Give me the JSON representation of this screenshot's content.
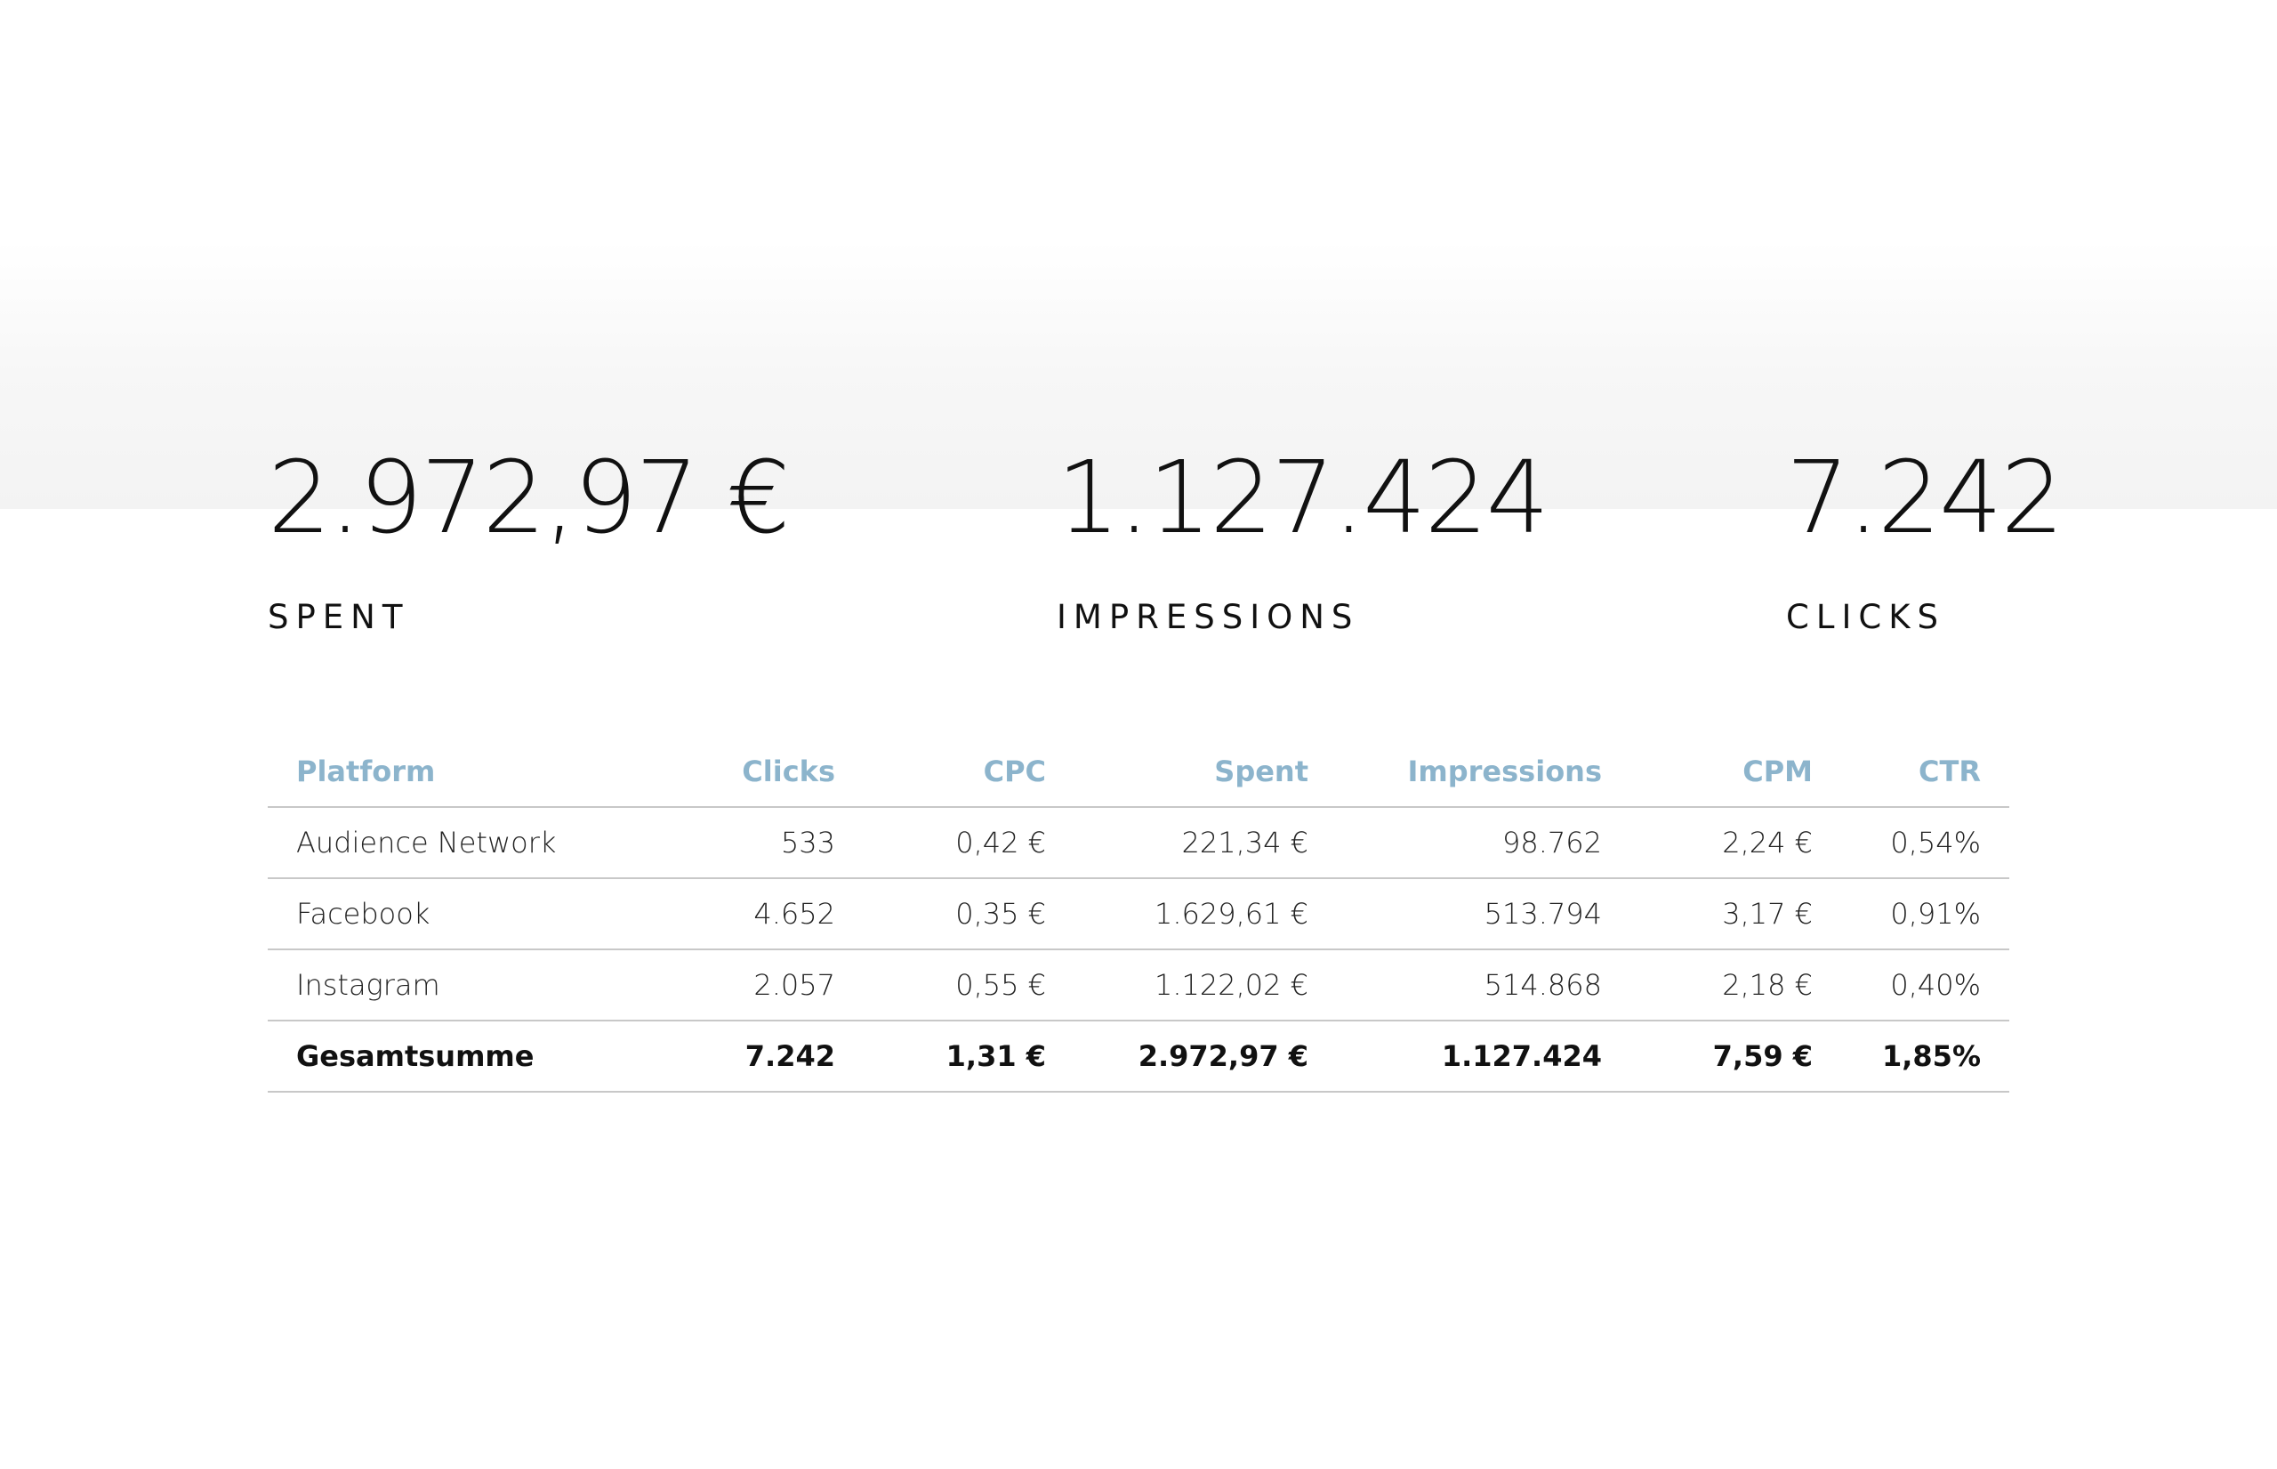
{
  "kpis": {
    "spent": {
      "value": "2.972,97 €",
      "label": "SPENT"
    },
    "impressions": {
      "value": "1.127.424",
      "label": "IMPRESSIONS"
    },
    "clicks": {
      "value": "7.242",
      "label": "CLICKS"
    }
  },
  "table": {
    "headers": [
      "Platform",
      "Clicks",
      "CPC",
      "Spent",
      "Impressions",
      "CPM",
      "CTR"
    ],
    "rows": [
      [
        "Audience Network",
        "533",
        "0,42 €",
        "221,34 €",
        "98.762",
        "2,24 €",
        "0,54%"
      ],
      [
        "Facebook",
        "4.652",
        "0,35 €",
        "1.629,61 €",
        "513.794",
        "3,17 €",
        "0,91%"
      ],
      [
        "Instagram",
        "2.057",
        "0,55 €",
        "1.122,02 €",
        "514.868",
        "2,18 €",
        "0,40%"
      ]
    ],
    "total": [
      "Gesamtsumme",
      "7.242",
      "1,31 €",
      "2.972,97 €",
      "1.127.424",
      "7,59 €",
      "1,85%"
    ]
  },
  "colors": {
    "header_text": "#8cb4cc",
    "row_divider": "#c8c8c8",
    "band_background": "#f3f3f3"
  }
}
